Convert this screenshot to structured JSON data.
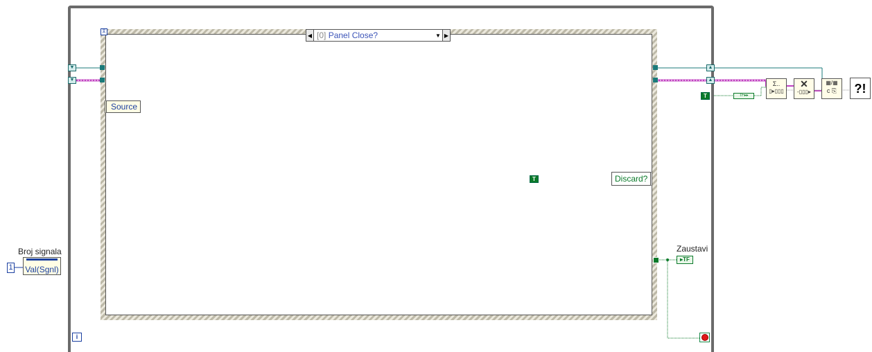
{
  "case_selector": {
    "index": "[0]",
    "event": "Panel Close?"
  },
  "labels": {
    "source": "Source",
    "discard": "Discard?",
    "zaustavi": "Zaustavi",
    "broj_signala": "Broj signala",
    "val_sgnl": "Val(Sgnl)",
    "constant_one": "1",
    "true_const": "T",
    "tf_indicator": "TF",
    "iteration": "i"
  },
  "icons": [
    "case-selector-left-arrow-icon",
    "case-selector-dropdown-icon",
    "case-selector-right-arrow-icon",
    "stop-condition-icon",
    "iteration-terminal-icon",
    "build-array-icon",
    "close-reference-icon",
    "convert-icon",
    "error-handler-icon"
  ],
  "colors": {
    "loop_border": "#6b6b6b",
    "event_wire": "#1a7a7a",
    "error_wire": "#c040c0",
    "boolean_wire": "#0b7a2a",
    "text_blue": "#1a3fa0"
  }
}
